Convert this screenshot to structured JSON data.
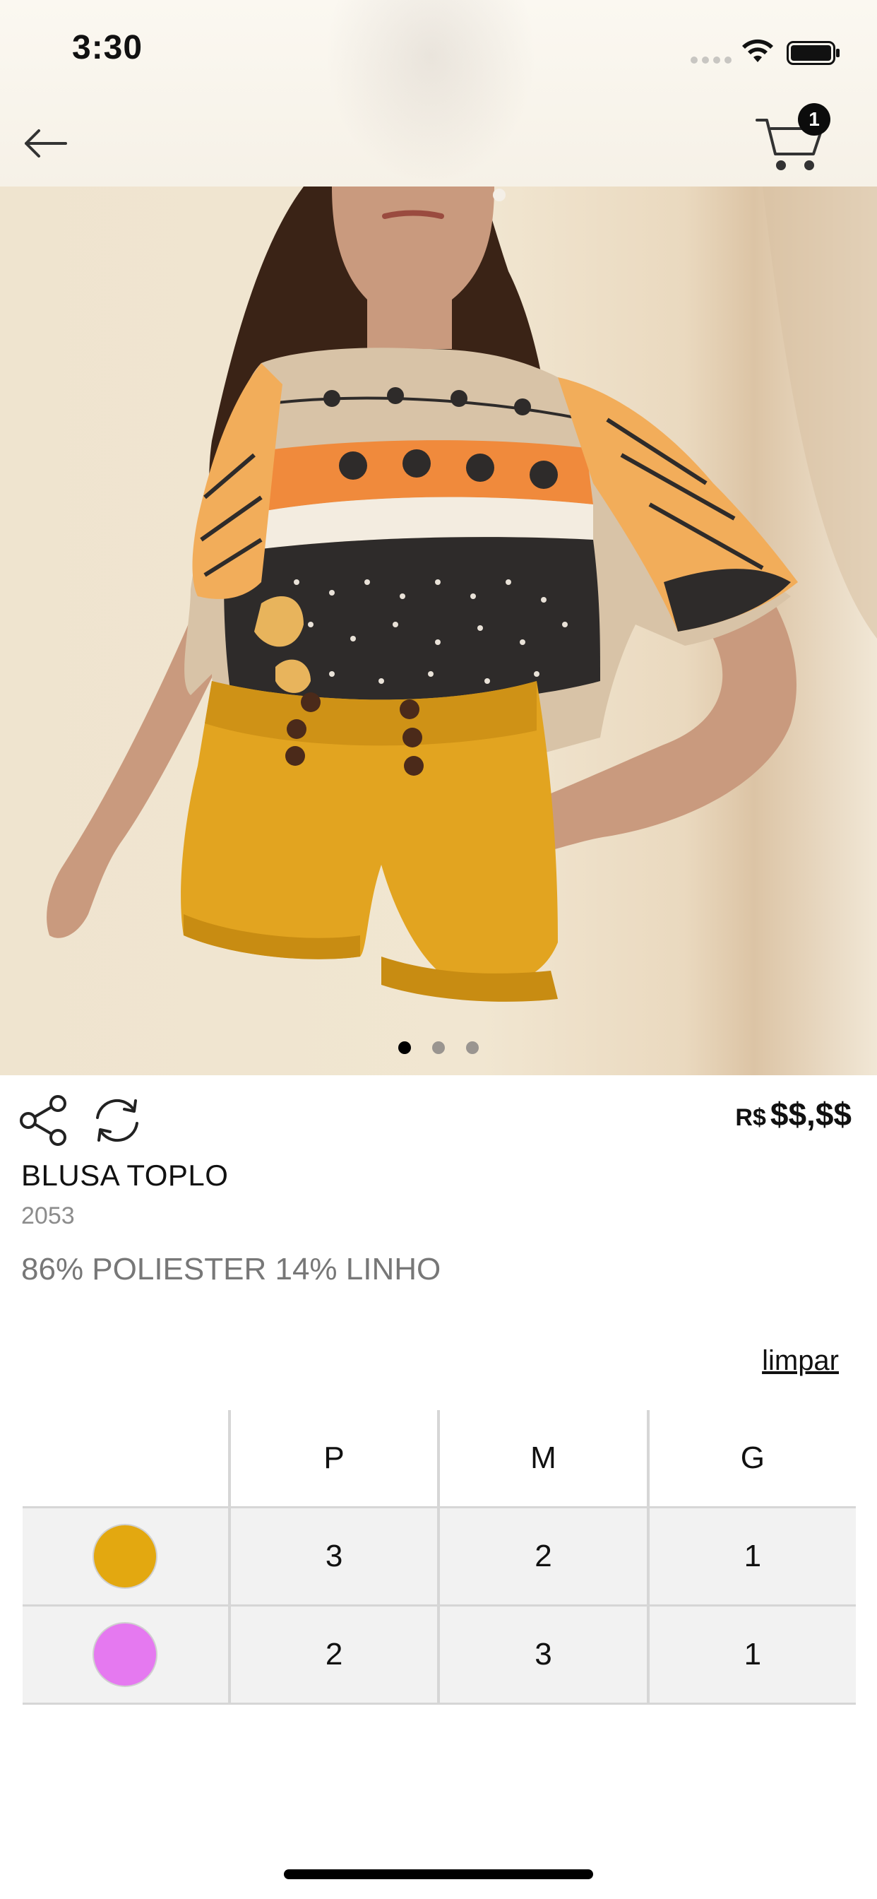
{
  "status_bar": {
    "time": "3:30"
  },
  "header": {
    "cart_count": "1"
  },
  "gallery": {
    "image_count": 3,
    "active_index": 0
  },
  "product": {
    "price_currency": "R$",
    "price_value": "$$,$$",
    "title": "BLUSA TOPLO",
    "code": "2053",
    "composition": "86% POLIESTER 14% LINHO"
  },
  "clear_label": "limpar",
  "grid": {
    "sizes": [
      "P",
      "M",
      "G"
    ],
    "rows": [
      {
        "color": "#E3A810",
        "qty": [
          "3",
          "2",
          "1"
        ]
      },
      {
        "color": "#E579F0",
        "qty": [
          "2",
          "3",
          "1"
        ]
      }
    ]
  },
  "icons": {
    "back": "arrow-left-icon",
    "cart": "cart-icon",
    "share": "share-icon",
    "refresh": "refresh-icon"
  }
}
